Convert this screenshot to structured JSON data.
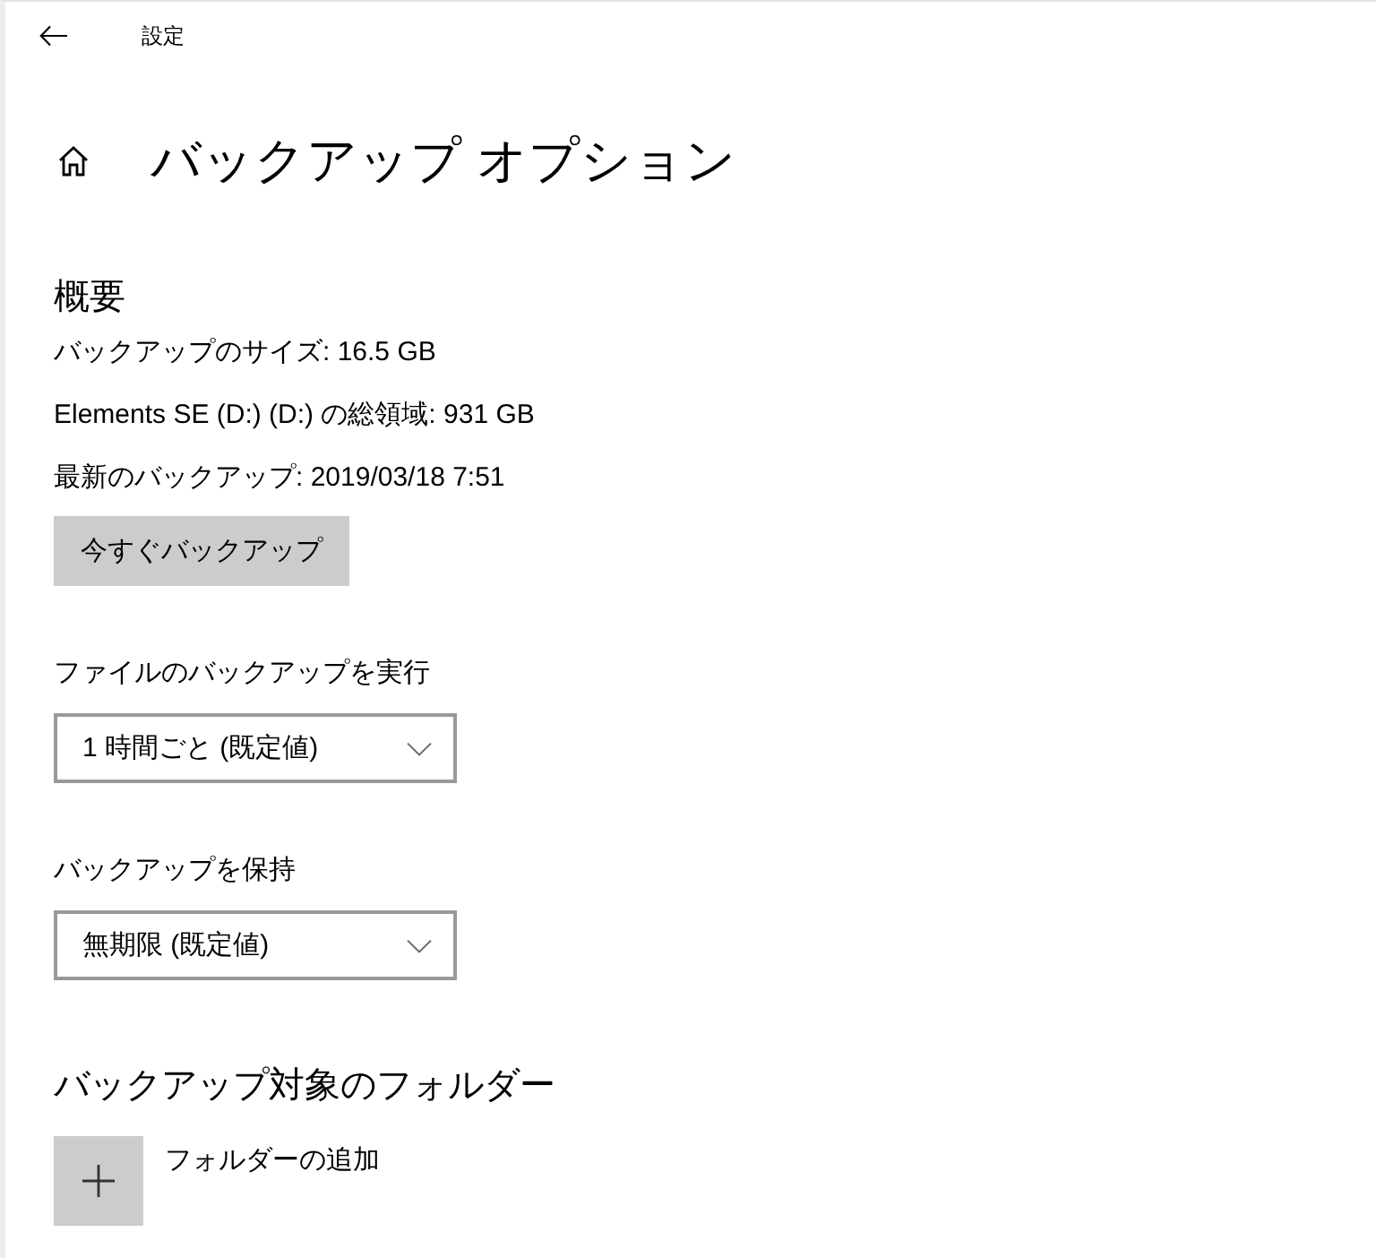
{
  "header": {
    "title": "設定"
  },
  "page": {
    "title": "バックアップ オプション"
  },
  "overview": {
    "heading": "概要",
    "lines": [
      "バックアップのサイズ: 16.5 GB",
      "Elements SE (D:) (D:) の総領域: 931 GB",
      "最新のバックアップ: 2019/03/18 7:51"
    ],
    "button": "今すぐバックアップ"
  },
  "settings": [
    {
      "label": "ファイルのバックアップを実行",
      "value": "1 時間ごと (既定値)"
    },
    {
      "label": "バックアップを保持",
      "value": "無期限 (既定値)"
    }
  ],
  "folders": {
    "heading": "バックアップ対象のフォルダー",
    "add_label": "フォルダーの追加"
  }
}
